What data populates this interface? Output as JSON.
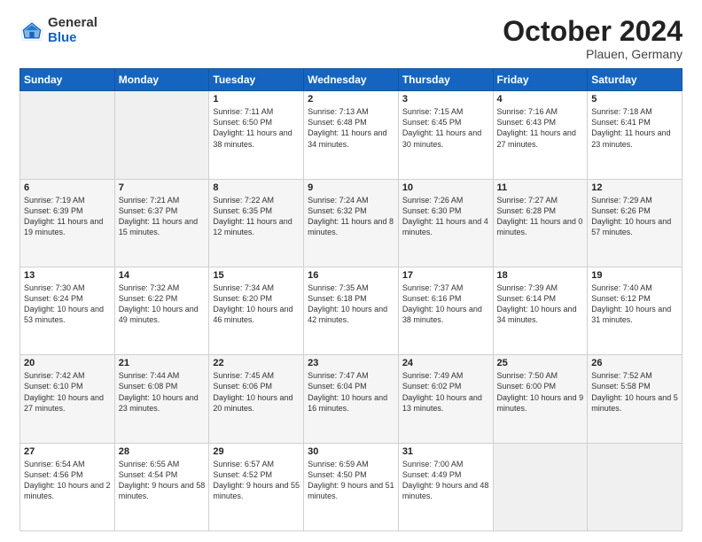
{
  "header": {
    "logo_general": "General",
    "logo_blue": "Blue",
    "month": "October 2024",
    "location": "Plauen, Germany"
  },
  "days_of_week": [
    "Sunday",
    "Monday",
    "Tuesday",
    "Wednesday",
    "Thursday",
    "Friday",
    "Saturday"
  ],
  "weeks": [
    [
      {
        "day": "",
        "sunrise": "",
        "sunset": "",
        "daylight": ""
      },
      {
        "day": "",
        "sunrise": "",
        "sunset": "",
        "daylight": ""
      },
      {
        "day": "1",
        "sunrise": "Sunrise: 7:11 AM",
        "sunset": "Sunset: 6:50 PM",
        "daylight": "Daylight: 11 hours and 38 minutes."
      },
      {
        "day": "2",
        "sunrise": "Sunrise: 7:13 AM",
        "sunset": "Sunset: 6:48 PM",
        "daylight": "Daylight: 11 hours and 34 minutes."
      },
      {
        "day": "3",
        "sunrise": "Sunrise: 7:15 AM",
        "sunset": "Sunset: 6:45 PM",
        "daylight": "Daylight: 11 hours and 30 minutes."
      },
      {
        "day": "4",
        "sunrise": "Sunrise: 7:16 AM",
        "sunset": "Sunset: 6:43 PM",
        "daylight": "Daylight: 11 hours and 27 minutes."
      },
      {
        "day": "5",
        "sunrise": "Sunrise: 7:18 AM",
        "sunset": "Sunset: 6:41 PM",
        "daylight": "Daylight: 11 hours and 23 minutes."
      }
    ],
    [
      {
        "day": "6",
        "sunrise": "Sunrise: 7:19 AM",
        "sunset": "Sunset: 6:39 PM",
        "daylight": "Daylight: 11 hours and 19 minutes."
      },
      {
        "day": "7",
        "sunrise": "Sunrise: 7:21 AM",
        "sunset": "Sunset: 6:37 PM",
        "daylight": "Daylight: 11 hours and 15 minutes."
      },
      {
        "day": "8",
        "sunrise": "Sunrise: 7:22 AM",
        "sunset": "Sunset: 6:35 PM",
        "daylight": "Daylight: 11 hours and 12 minutes."
      },
      {
        "day": "9",
        "sunrise": "Sunrise: 7:24 AM",
        "sunset": "Sunset: 6:32 PM",
        "daylight": "Daylight: 11 hours and 8 minutes."
      },
      {
        "day": "10",
        "sunrise": "Sunrise: 7:26 AM",
        "sunset": "Sunset: 6:30 PM",
        "daylight": "Daylight: 11 hours and 4 minutes."
      },
      {
        "day": "11",
        "sunrise": "Sunrise: 7:27 AM",
        "sunset": "Sunset: 6:28 PM",
        "daylight": "Daylight: 11 hours and 0 minutes."
      },
      {
        "day": "12",
        "sunrise": "Sunrise: 7:29 AM",
        "sunset": "Sunset: 6:26 PM",
        "daylight": "Daylight: 10 hours and 57 minutes."
      }
    ],
    [
      {
        "day": "13",
        "sunrise": "Sunrise: 7:30 AM",
        "sunset": "Sunset: 6:24 PM",
        "daylight": "Daylight: 10 hours and 53 minutes."
      },
      {
        "day": "14",
        "sunrise": "Sunrise: 7:32 AM",
        "sunset": "Sunset: 6:22 PM",
        "daylight": "Daylight: 10 hours and 49 minutes."
      },
      {
        "day": "15",
        "sunrise": "Sunrise: 7:34 AM",
        "sunset": "Sunset: 6:20 PM",
        "daylight": "Daylight: 10 hours and 46 minutes."
      },
      {
        "day": "16",
        "sunrise": "Sunrise: 7:35 AM",
        "sunset": "Sunset: 6:18 PM",
        "daylight": "Daylight: 10 hours and 42 minutes."
      },
      {
        "day": "17",
        "sunrise": "Sunrise: 7:37 AM",
        "sunset": "Sunset: 6:16 PM",
        "daylight": "Daylight: 10 hours and 38 minutes."
      },
      {
        "day": "18",
        "sunrise": "Sunrise: 7:39 AM",
        "sunset": "Sunset: 6:14 PM",
        "daylight": "Daylight: 10 hours and 34 minutes."
      },
      {
        "day": "19",
        "sunrise": "Sunrise: 7:40 AM",
        "sunset": "Sunset: 6:12 PM",
        "daylight": "Daylight: 10 hours and 31 minutes."
      }
    ],
    [
      {
        "day": "20",
        "sunrise": "Sunrise: 7:42 AM",
        "sunset": "Sunset: 6:10 PM",
        "daylight": "Daylight: 10 hours and 27 minutes."
      },
      {
        "day": "21",
        "sunrise": "Sunrise: 7:44 AM",
        "sunset": "Sunset: 6:08 PM",
        "daylight": "Daylight: 10 hours and 23 minutes."
      },
      {
        "day": "22",
        "sunrise": "Sunrise: 7:45 AM",
        "sunset": "Sunset: 6:06 PM",
        "daylight": "Daylight: 10 hours and 20 minutes."
      },
      {
        "day": "23",
        "sunrise": "Sunrise: 7:47 AM",
        "sunset": "Sunset: 6:04 PM",
        "daylight": "Daylight: 10 hours and 16 minutes."
      },
      {
        "day": "24",
        "sunrise": "Sunrise: 7:49 AM",
        "sunset": "Sunset: 6:02 PM",
        "daylight": "Daylight: 10 hours and 13 minutes."
      },
      {
        "day": "25",
        "sunrise": "Sunrise: 7:50 AM",
        "sunset": "Sunset: 6:00 PM",
        "daylight": "Daylight: 10 hours and 9 minutes."
      },
      {
        "day": "26",
        "sunrise": "Sunrise: 7:52 AM",
        "sunset": "Sunset: 5:58 PM",
        "daylight": "Daylight: 10 hours and 5 minutes."
      }
    ],
    [
      {
        "day": "27",
        "sunrise": "Sunrise: 6:54 AM",
        "sunset": "Sunset: 4:56 PM",
        "daylight": "Daylight: 10 hours and 2 minutes."
      },
      {
        "day": "28",
        "sunrise": "Sunrise: 6:55 AM",
        "sunset": "Sunset: 4:54 PM",
        "daylight": "Daylight: 9 hours and 58 minutes."
      },
      {
        "day": "29",
        "sunrise": "Sunrise: 6:57 AM",
        "sunset": "Sunset: 4:52 PM",
        "daylight": "Daylight: 9 hours and 55 minutes."
      },
      {
        "day": "30",
        "sunrise": "Sunrise: 6:59 AM",
        "sunset": "Sunset: 4:50 PM",
        "daylight": "Daylight: 9 hours and 51 minutes."
      },
      {
        "day": "31",
        "sunrise": "Sunrise: 7:00 AM",
        "sunset": "Sunset: 4:49 PM",
        "daylight": "Daylight: 9 hours and 48 minutes."
      },
      {
        "day": "",
        "sunrise": "",
        "sunset": "",
        "daylight": ""
      },
      {
        "day": "",
        "sunrise": "",
        "sunset": "",
        "daylight": ""
      }
    ]
  ]
}
